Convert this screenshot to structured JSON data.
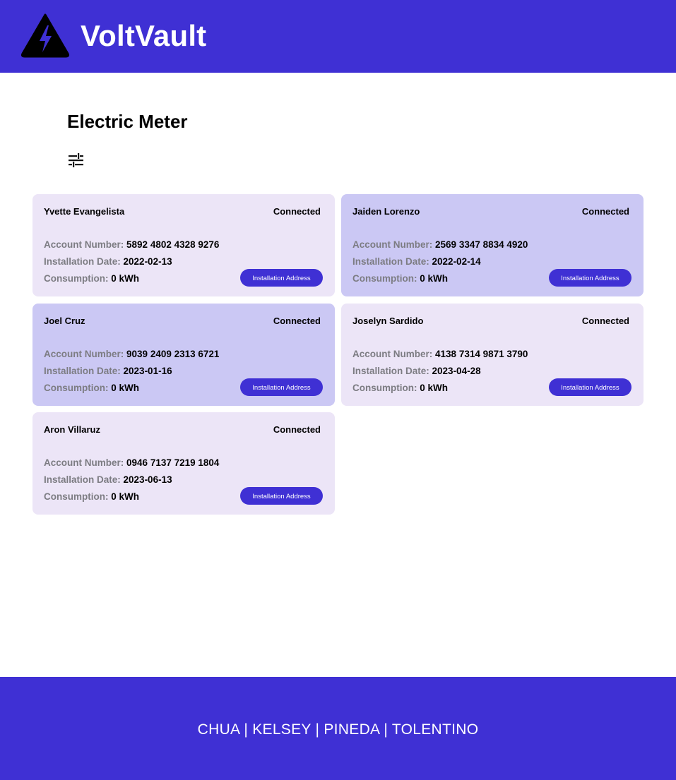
{
  "header": {
    "brand": "VoltVault",
    "logo_icon": "lightning-triangle-icon",
    "background_color": "#3f30d4"
  },
  "main": {
    "title": "Electric Meter",
    "filter_icon": "sliders-icon"
  },
  "labels": {
    "account_number": "Account Number:",
    "installation_date": "Installation Date:",
    "consumption": "Consumption:",
    "address_button": "Installation Address"
  },
  "meters": [
    {
      "name": "Yvette Evangelista",
      "status": "Connected",
      "account_number": "5892 4802 4328 9276",
      "installation_date": "2022-02-13",
      "consumption": "0 kWh",
      "card_color": "#ece5f7"
    },
    {
      "name": "Jaiden Lorenzo",
      "status": "Connected",
      "account_number": "2569 3347 8834 4920",
      "installation_date": "2022-02-14",
      "consumption": "0 kWh",
      "card_color": "#cbc8f4"
    },
    {
      "name": "Joel Cruz",
      "status": "Connected",
      "account_number": "9039 2409 2313 6721",
      "installation_date": "2023-01-16",
      "consumption": "0 kWh",
      "card_color": "#cbc8f4"
    },
    {
      "name": "Joselyn Sardido",
      "status": "Connected",
      "account_number": "4138 7314 9871 3790",
      "installation_date": "2023-04-28",
      "consumption": "0 kWh",
      "card_color": "#ece5f7"
    },
    {
      "name": "Aron Villaruz",
      "status": "Connected",
      "account_number": "0946 7137 7219 1804",
      "installation_date": "2023-06-13",
      "consumption": "0 kWh",
      "card_color": "#ece5f7"
    }
  ],
  "footer": {
    "text": "CHUA | KELSEY | PINEDA | TOLENTINO"
  }
}
